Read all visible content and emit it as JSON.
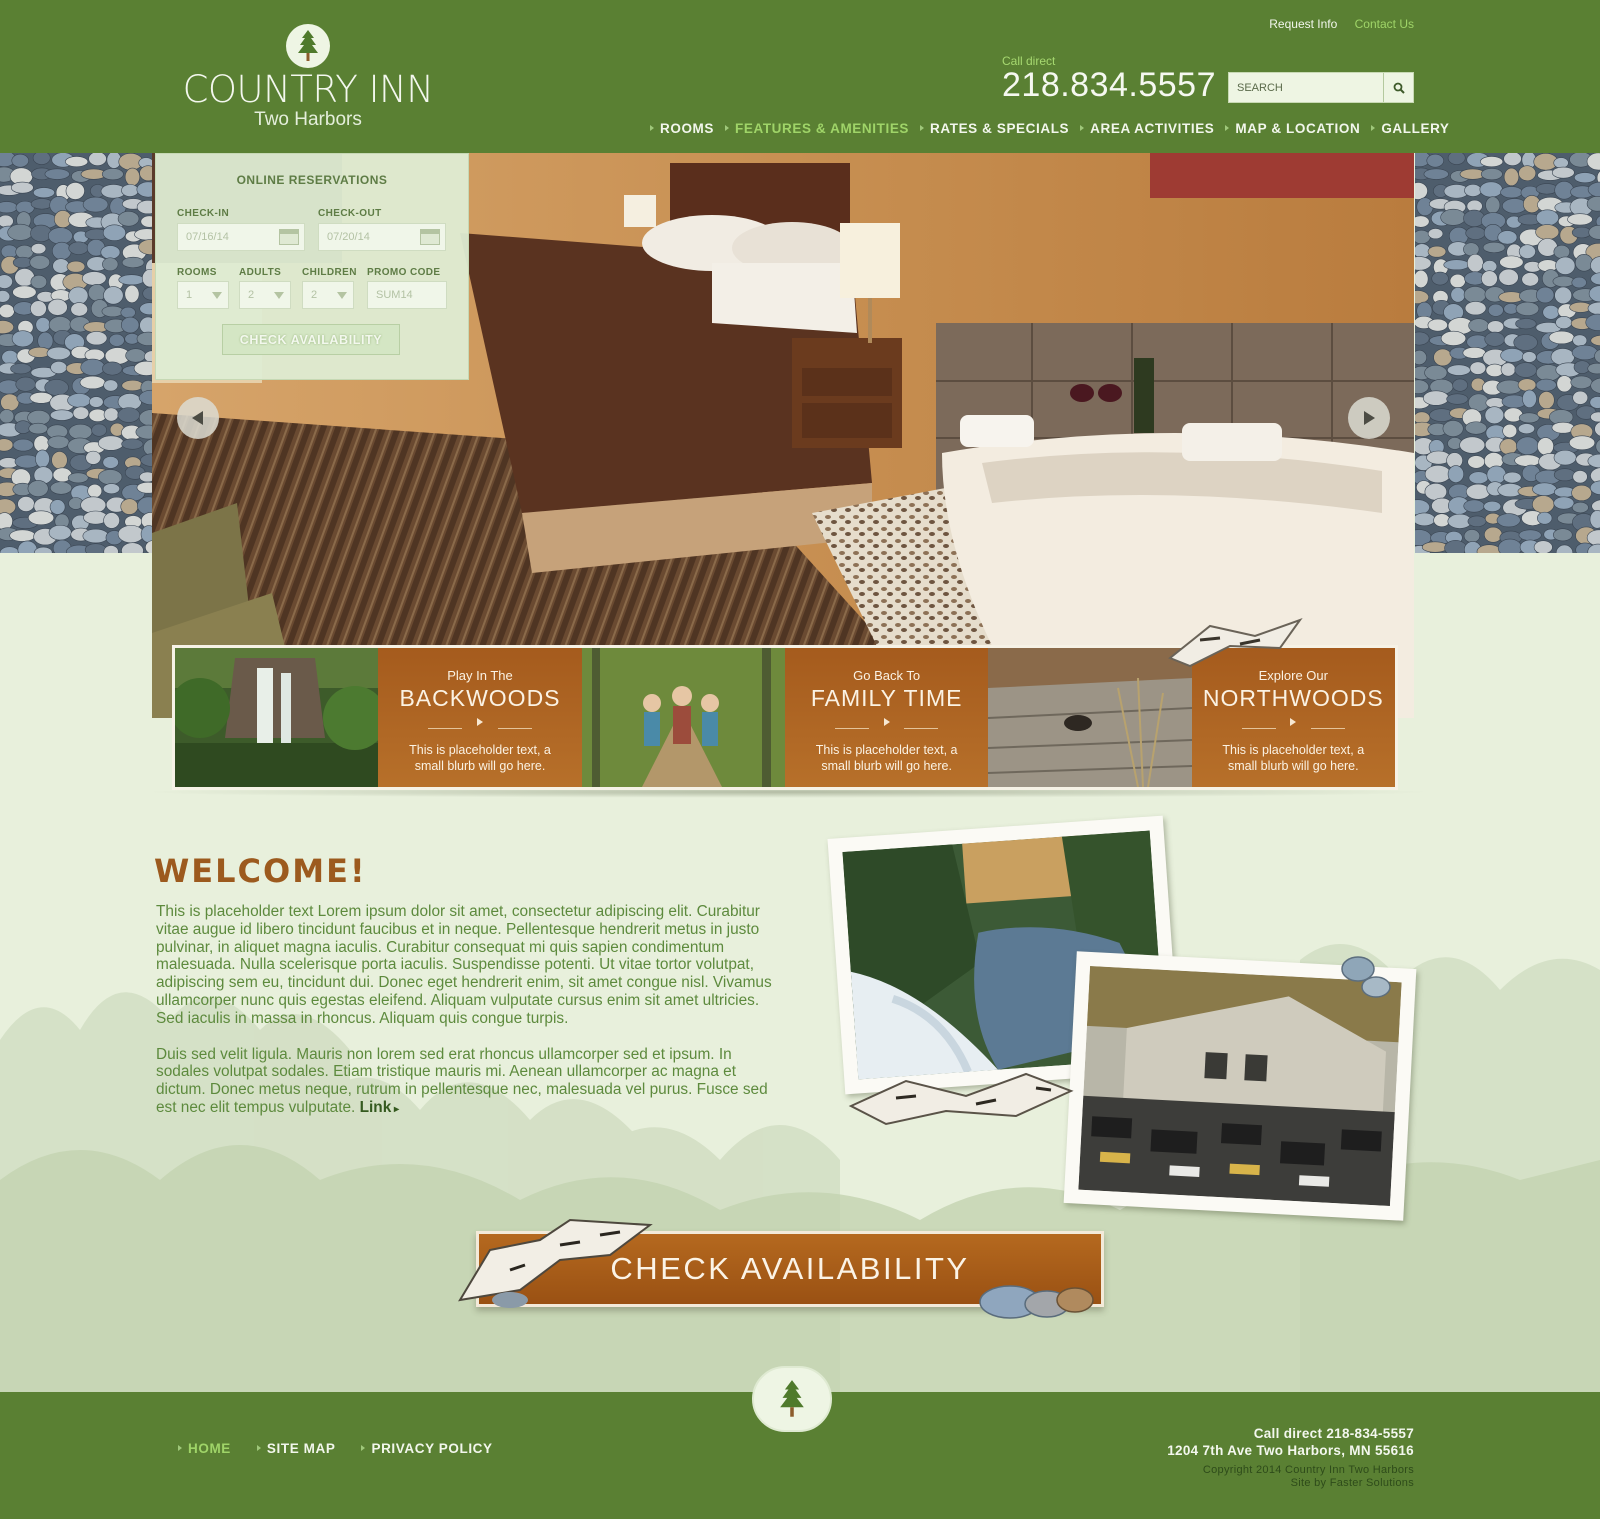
{
  "brand": {
    "name": "COUNTRY INN",
    "location": "Two Harbors",
    "logo_icon": "pine-tree-icon"
  },
  "top_links": {
    "request_info": "Request Info",
    "contact_us": "Contact Us"
  },
  "call": {
    "label": "Call direct",
    "number": "218.834.5557"
  },
  "search": {
    "placeholder": "SEARCH",
    "icon": "search-icon"
  },
  "nav": {
    "items": [
      {
        "label": "ROOMS"
      },
      {
        "label": "FEATURES & AMENITIES",
        "active": true
      },
      {
        "label": "RATES & SPECIALS"
      },
      {
        "label": "AREA ACTIVITIES"
      },
      {
        "label": "MAP & LOCATION"
      },
      {
        "label": "GALLERY"
      }
    ]
  },
  "reservation": {
    "title": "ONLINE RESERVATIONS",
    "checkin_label": "CHECK-IN",
    "checkin_value": "07/16/14",
    "checkout_label": "CHECK-OUT",
    "checkout_value": "07/20/14",
    "rooms_label": "ROOMS",
    "rooms_value": "1",
    "adults_label": "ADULTS",
    "adults_value": "2",
    "children_label": "CHILDREN",
    "children_value": "2",
    "promo_label": "PROMO CODE",
    "promo_placeholder": "SUM14",
    "button": "CHECK AVAILABILITY"
  },
  "features": [
    {
      "kicker": "Play In The",
      "headline": "BACKWOODS",
      "blurb": "This is placeholder text, a small blurb will go here."
    },
    {
      "kicker": "Go Back To",
      "headline": "FAMILY TIME",
      "blurb": "This is placeholder text, a small blurb will go here."
    },
    {
      "kicker": "Explore Our",
      "headline": "NORTHWOODS",
      "blurb": "This is placeholder text, a small blurb will go here."
    }
  ],
  "welcome": {
    "title": "WELCOME!",
    "p1": "This is placeholder text Lorem ipsum dolor sit amet, consectetur adipiscing elit. Curabitur vitae augue id libero tincidunt faucibus et in neque. Pellentesque hendrerit metus in justo pulvinar, in aliquet magna iaculis. Curabitur consequat mi quis sapien condimentum malesuada. Nulla scelerisque porta iaculis. Suspendisse potenti. Ut vitae tortor volutpat, adipiscing sem eu, tincidunt dui. Donec eget hendrerit enim, sit amet congue nisl. Vivamus ullamcorper nunc quis egestas eleifend. Aliquam vulputate cursus enim sit amet ultricies. Sed iaculis in massa in rhoncus. Aliquam quis congue turpis.",
    "p2": "Duis sed velit ligula. Mauris non lorem sed erat rhoncus ullamcorper sed et ipsum. In sodales volutpat sodales. Etiam tristique mauris mi. Aenean ullamcorper ac magna et dictum. Donec metus neque, rutrum in pellentesque nec, malesuada vel purus. Fusce sed est nec elit tempus vulputate.",
    "link": "Link"
  },
  "cta": {
    "label": "CHECK AVAILABILITY"
  },
  "footer": {
    "nav": [
      {
        "label": "HOME",
        "active": true
      },
      {
        "label": "SITE MAP"
      },
      {
        "label": "PRIVACY POLICY"
      }
    ],
    "call": "Call direct 218-834-5557",
    "address": "1204 7th Ave Two Harbors, MN 55616",
    "copyright": "Copyright 2014 Country Inn Two Harbors",
    "credit": "Site by Faster Solutions"
  },
  "colors": {
    "header_green": "#5a8033",
    "accent_green": "#9fd468",
    "brown": "#a55b1d",
    "page_bg": "#e8f0dc"
  }
}
